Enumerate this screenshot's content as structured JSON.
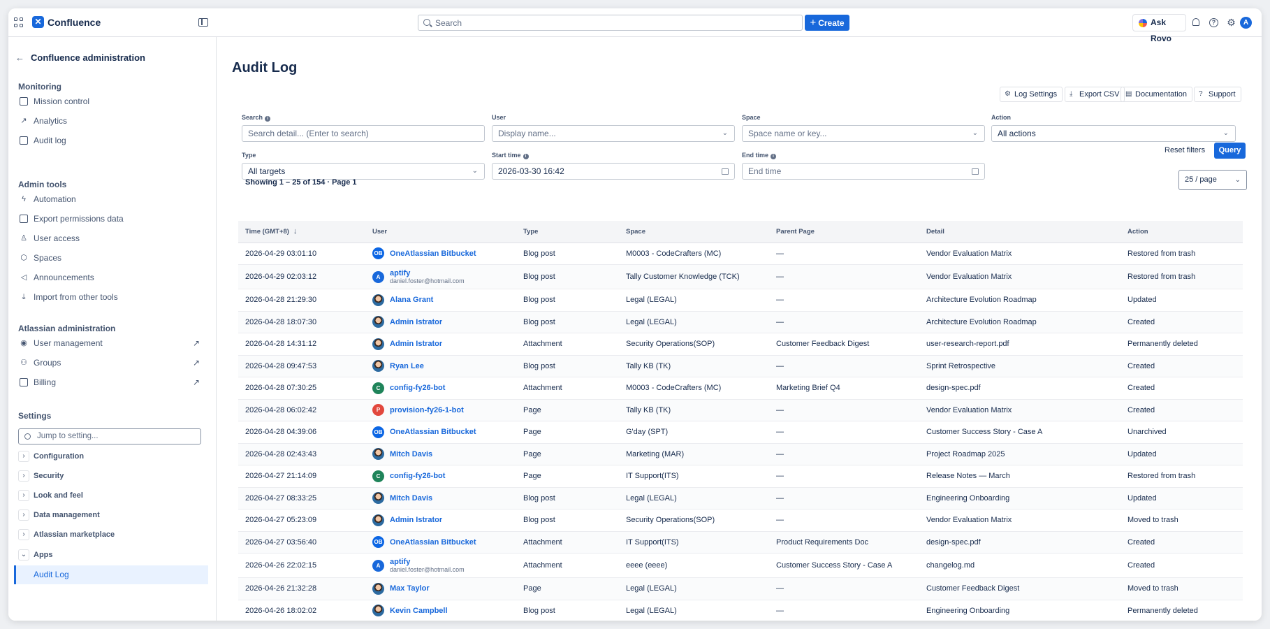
{
  "app": {
    "name": "Confluence"
  },
  "topbar": {
    "search_placeholder": "Search",
    "create_label": "Create",
    "rovo_label": "Ask Rovo",
    "avatar_initial": "A"
  },
  "sidebar": {
    "back_label": "Confluence administration",
    "monitoring": {
      "heading": "Monitoring",
      "items": [
        "Mission control",
        "Analytics",
        "Audit log"
      ]
    },
    "admin_tools": {
      "heading": "Admin tools",
      "items": [
        "Automation",
        "Export permissions data",
        "User access",
        "Spaces",
        "Announcements",
        "Import from other tools"
      ]
    },
    "atlassian_admin": {
      "heading": "Atlassian administration",
      "items": [
        "User management",
        "Groups",
        "Billing"
      ]
    },
    "settings": {
      "heading": "Settings",
      "jump_placeholder": "Jump to setting...",
      "items": [
        "Configuration",
        "Security",
        "Look and feel",
        "Data management",
        "Atlassian marketplace",
        "Apps"
      ],
      "active_item": "Audit Log"
    }
  },
  "main": {
    "title": "Audit Log",
    "toolbar": {
      "log_settings": "Log Settings",
      "export_csv": "Export CSV",
      "documentation": "Documentation",
      "support": "Support"
    },
    "filters": {
      "search_label": "Search",
      "search_placeholder": "Search detail... (Enter to search)",
      "user_label": "User",
      "user_placeholder": "Display name...",
      "space_label": "Space",
      "space_placeholder": "Space name or key...",
      "action_label": "Action",
      "action_value": "All actions",
      "type_label": "Type",
      "type_value": "All targets",
      "start_label": "Start time",
      "start_value": "2026-03-30 16:42",
      "end_label": "End time",
      "end_placeholder": "End time",
      "reset_label": "Reset filters",
      "query_label": "Query"
    },
    "showing": "Showing 1 – 25 of 154 · Page 1",
    "per_page": "25 / page",
    "columns": [
      "Time (GMT+8)",
      "User",
      "Type",
      "Space",
      "Parent Page",
      "Detail",
      "Action"
    ],
    "rows": [
      {
        "time": "2026-04-29 03:01:10",
        "user": "OneAtlassian Bitbucket",
        "email": "",
        "avatar": "OB",
        "avatar_color": "#0c66e4",
        "type": "Blog post",
        "space": "M0003 - CodeCrafters (MC)",
        "space_muted": false,
        "parent": "—",
        "parent_link": false,
        "detail": "Vendor Evaluation Matrix",
        "detail_link": true,
        "action": "Restored from trash"
      },
      {
        "time": "2026-04-29 02:03:12",
        "user": "aptify",
        "email": "daniel.foster@hotmail.com",
        "avatar": "A",
        "avatar_color": "#1868db",
        "type": "Blog post",
        "space": "Tally Customer Knowledge (TCK)",
        "space_muted": false,
        "parent": "—",
        "parent_link": false,
        "detail": "Vendor Evaluation Matrix",
        "detail_link": true,
        "action": "Restored from trash"
      },
      {
        "time": "2026-04-28 21:29:30",
        "user": "Alana Grant",
        "email": "",
        "avatar": "",
        "avatar_color": "photo",
        "type": "Blog post",
        "space": "Legal (LEGAL)",
        "space_muted": false,
        "parent": "—",
        "parent_link": false,
        "detail": "Architecture Evolution Roadmap",
        "detail_link": true,
        "action": "Updated"
      },
      {
        "time": "2026-04-28 18:07:30",
        "user": "Admin Istrator",
        "email": "",
        "avatar": "",
        "avatar_color": "photo",
        "type": "Blog post",
        "space": "Legal (LEGAL)",
        "space_muted": false,
        "parent": "—",
        "parent_link": false,
        "detail": "Architecture Evolution Roadmap",
        "detail_link": true,
        "action": "Created"
      },
      {
        "time": "2026-04-28 14:31:12",
        "user": "Admin Istrator",
        "email": "",
        "avatar": "",
        "avatar_color": "photo",
        "type": "Attachment",
        "space": "Security Operations(SOP)",
        "space_muted": true,
        "parent": "Customer Feedback Digest",
        "parent_link": true,
        "detail": "user-research-report.pdf",
        "detail_link": false,
        "action": "Permanently deleted"
      },
      {
        "time": "2026-04-28 09:47:53",
        "user": "Ryan Lee",
        "email": "",
        "avatar": "",
        "avatar_color": "photo",
        "type": "Blog post",
        "space": "Tally KB (TK)",
        "space_muted": false,
        "parent": "—",
        "parent_link": false,
        "detail": "Sprint Retrospective",
        "detail_link": true,
        "action": "Created"
      },
      {
        "time": "2026-04-28 07:30:25",
        "user": "config-fy26-bot",
        "email": "",
        "avatar": "C",
        "avatar_color": "#1f845a",
        "type": "Attachment",
        "space": "M0003 - CodeCrafters (MC)",
        "space_muted": false,
        "parent": "Marketing Brief Q4",
        "parent_link": true,
        "detail": "design-spec.pdf",
        "detail_link": false,
        "action": "Created"
      },
      {
        "time": "2026-04-28 06:02:42",
        "user": "provision-fy26-1-bot",
        "email": "",
        "avatar": "P",
        "avatar_color": "#e2483d",
        "type": "Page",
        "space": "Tally KB (TK)",
        "space_muted": false,
        "parent": "—",
        "parent_link": false,
        "detail": "Vendor Evaluation Matrix",
        "detail_link": true,
        "action": "Created"
      },
      {
        "time": "2026-04-28 04:39:06",
        "user": "OneAtlassian Bitbucket",
        "email": "",
        "avatar": "OB",
        "avatar_color": "#0c66e4",
        "type": "Page",
        "space": "G'day (SPT)",
        "space_muted": false,
        "parent": "—",
        "parent_link": false,
        "detail": "Customer Success Story - Case A",
        "detail_link": true,
        "action": "Unarchived"
      },
      {
        "time": "2026-04-28 02:43:43",
        "user": "Mitch Davis",
        "email": "",
        "avatar": "",
        "avatar_color": "photo",
        "type": "Page",
        "space": "Marketing (MAR)",
        "space_muted": false,
        "parent": "—",
        "parent_link": false,
        "detail": "Project Roadmap 2025",
        "detail_link": true,
        "action": "Updated"
      },
      {
        "time": "2026-04-27 21:14:09",
        "user": "config-fy26-bot",
        "email": "",
        "avatar": "C",
        "avatar_color": "#1f845a",
        "type": "Page",
        "space": "IT Support(ITS)",
        "space_muted": false,
        "parent": "—",
        "parent_link": false,
        "detail": "Release Notes — March",
        "detail_link": true,
        "action": "Restored from trash"
      },
      {
        "time": "2026-04-27 08:33:25",
        "user": "Mitch Davis",
        "email": "",
        "avatar": "",
        "avatar_color": "photo",
        "type": "Blog post",
        "space": "Legal (LEGAL)",
        "space_muted": false,
        "parent": "—",
        "parent_link": false,
        "detail": "Engineering Onboarding",
        "detail_link": true,
        "action": "Updated"
      },
      {
        "time": "2026-04-27 05:23:09",
        "user": "Admin Istrator",
        "email": "",
        "avatar": "",
        "avatar_color": "photo",
        "type": "Blog post",
        "space": "Security Operations(SOP)",
        "space_muted": false,
        "parent": "—",
        "parent_link": false,
        "detail": "Vendor Evaluation Matrix",
        "detail_link": false,
        "action": "Moved to trash"
      },
      {
        "time": "2026-04-27 03:56:40",
        "user": "OneAtlassian Bitbucket",
        "email": "",
        "avatar": "OB",
        "avatar_color": "#0c66e4",
        "type": "Attachment",
        "space": "IT Support(ITS)",
        "space_muted": true,
        "parent": "Product Requirements Doc",
        "parent_link": true,
        "detail": "design-spec.pdf",
        "detail_link": false,
        "action": "Created"
      },
      {
        "time": "2026-04-26 22:02:15",
        "user": "aptify",
        "email": "daniel.foster@hotmail.com",
        "avatar": "A",
        "avatar_color": "#1868db",
        "type": "Attachment",
        "space": "eeee (eeee)",
        "space_muted": false,
        "parent": "Customer Success Story - Case A",
        "parent_link": true,
        "detail": "changelog.md",
        "detail_link": false,
        "action": "Created"
      },
      {
        "time": "2026-04-26 21:32:28",
        "user": "Max Taylor",
        "email": "",
        "avatar": "",
        "avatar_color": "photo",
        "type": "Page",
        "space": "Legal (LEGAL)",
        "space_muted": false,
        "parent": "—",
        "parent_link": false,
        "detail": "Customer Feedback Digest",
        "detail_link": false,
        "action": "Moved to trash"
      },
      {
        "time": "2026-04-26 18:02:02",
        "user": "Kevin Campbell",
        "email": "",
        "avatar": "",
        "avatar_color": "photo",
        "type": "Blog post",
        "space": "Legal (LEGAL)",
        "space_muted": false,
        "parent": "—",
        "parent_link": false,
        "detail": "Engineering Onboarding",
        "detail_link": false,
        "action": "Permanently deleted"
      }
    ]
  }
}
